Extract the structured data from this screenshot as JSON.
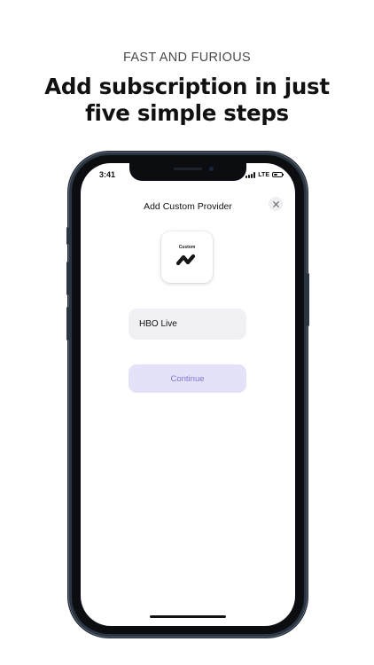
{
  "promo": {
    "eyebrow": "FAST AND FURIOUS",
    "headline_line1": "Add subscription in just",
    "headline_line2": "five simple steps"
  },
  "status_bar": {
    "time": "3:41",
    "network": "LTE"
  },
  "screen": {
    "title": "Add Custom Provider",
    "close_icon": "close-icon",
    "logo": {
      "label": "Custom",
      "icon": "custom-wave-logo-icon"
    },
    "name_input": {
      "value": "HBO Live"
    },
    "continue_label": "Continue"
  },
  "colors": {
    "frame": "#2b3441",
    "input_bg": "#f1f1f5",
    "button_bg": "#e4e2f8",
    "button_text": "#7e75d2"
  }
}
